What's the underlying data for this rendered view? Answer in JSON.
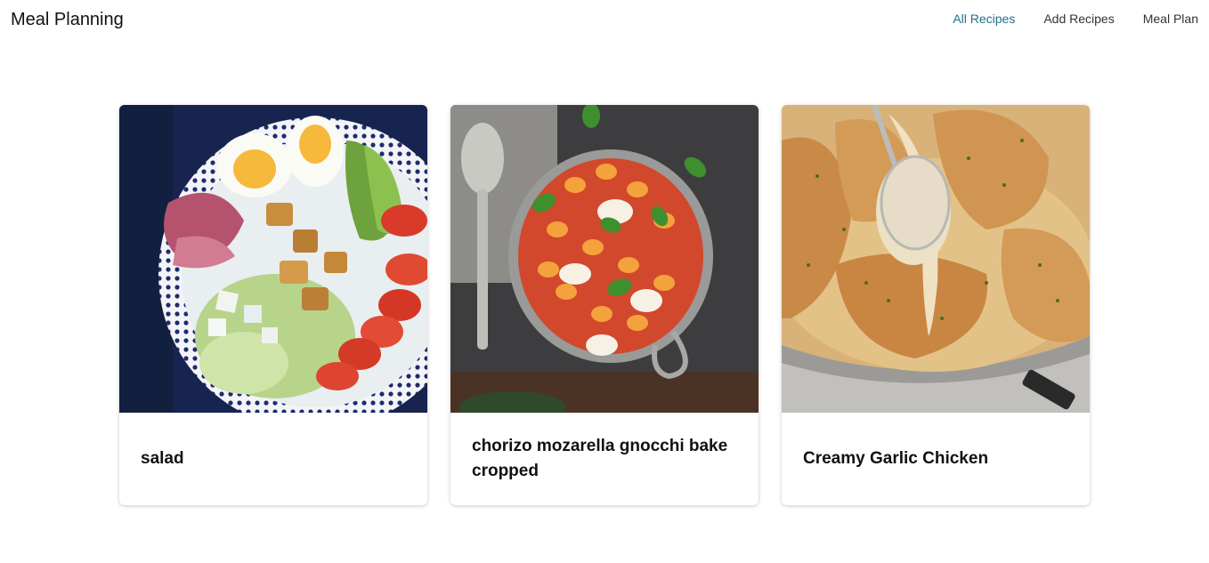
{
  "header": {
    "brand": "Meal Planning",
    "nav": [
      {
        "label": "All Recipes",
        "active": true
      },
      {
        "label": "Add Recipes",
        "active": false
      },
      {
        "label": "Meal Plan",
        "active": false
      }
    ]
  },
  "recipes": [
    {
      "title": "salad",
      "image": "salad-bowl-photo"
    },
    {
      "title": "chorizo mozarella gnocchi bake cropped",
      "image": "gnocchi-bake-photo"
    },
    {
      "title": "Creamy Garlic Chicken",
      "image": "creamy-chicken-photo"
    }
  ],
  "colors": {
    "accent": "#1f6f8b",
    "nav_text": "#333333",
    "title_text": "#111111"
  }
}
